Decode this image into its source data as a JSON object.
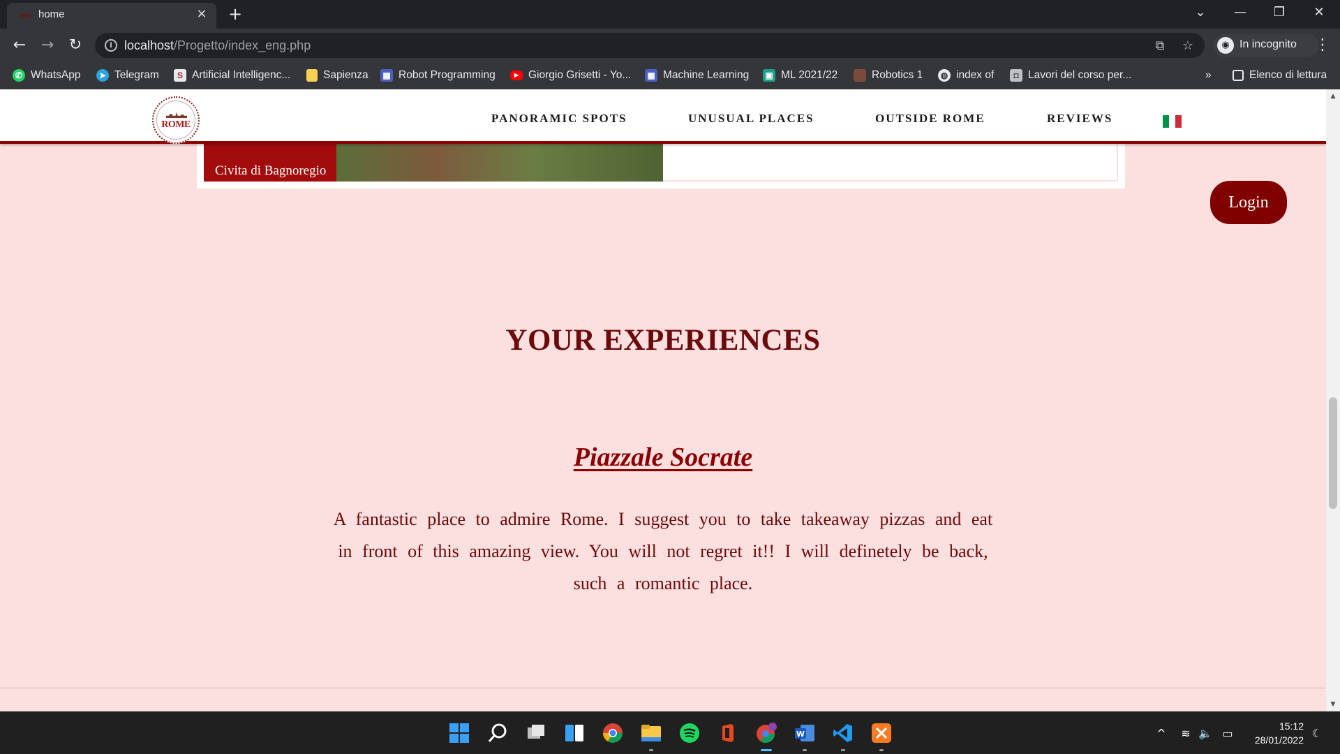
{
  "browser": {
    "tab": {
      "title": "home",
      "close_glyph": "×"
    },
    "new_tab_glyph": "+",
    "window": {
      "tabsearch_glyph": "⌄",
      "minimize_glyph": "—",
      "restore_glyph": "❐",
      "close_glyph": "✕"
    },
    "toolbar": {
      "back_glyph": "←",
      "forward_glyph": "→",
      "reload_glyph": "↻",
      "url_host": "localhost",
      "url_path": "/Progetto/index_eng.php",
      "translate_glyph": "⧉",
      "star_glyph": "☆",
      "incognito_label": "In incognito",
      "menu_glyph": "⋮"
    },
    "bookmarks": [
      {
        "label": "WhatsApp",
        "icon": "whatsapp-icon",
        "color": "#25d366"
      },
      {
        "label": "Telegram",
        "icon": "telegram-icon",
        "color": "#2aa3e0"
      },
      {
        "label": "Artificial Intelligenc...",
        "icon": "s-icon",
        "color": "#e8eaed"
      },
      {
        "label": "Sapienza",
        "icon": "folder-icon",
        "color": "#f7d154"
      },
      {
        "label": "Robot Programming",
        "icon": "classroom-icon",
        "color": "#4a5fc1"
      },
      {
        "label": "Giorgio Grisetti - Yo...",
        "icon": "youtube-icon",
        "color": "#ff0000"
      },
      {
        "label": "Machine Learning",
        "icon": "classroom-icon",
        "color": "#4a5fc1"
      },
      {
        "label": "ML 2021/22",
        "icon": "classroom-icon",
        "color": "#1e9e8a"
      },
      {
        "label": "Robotics 1",
        "icon": "person-icon",
        "color": "#7a4a3a"
      },
      {
        "label": "index of",
        "icon": "globe-icon",
        "color": "#e8eaed"
      },
      {
        "label": "Lavori del corso per...",
        "icon": "person-icon",
        "color": "#bdc1c6"
      }
    ],
    "bookmarks_overflow": "»",
    "reading_list_label": "Elenco di lettura"
  },
  "site": {
    "logo_text": "ROME",
    "nav": [
      "PANORAMIC SPOTS",
      "UNUSUAL PLACES",
      "OUTSIDE ROME",
      "REVIEWS"
    ],
    "flag_colors": [
      "#009246",
      "#ffffff",
      "#ce2b37"
    ],
    "strip_caption": "Civita di Bagnoregio",
    "login_label": "Login",
    "section_title": "YOUR EXPERIENCES",
    "review": {
      "title": "Piazzale Socrate",
      "text": "A fantastic place to admire Rome. I suggest you to take takeaway pizzas and eat in front of this amazing view. You will not regret it!! I will definetely be back, such a romantic place."
    },
    "accent_color": "#8b0000",
    "background_color": "#fcdfdf"
  },
  "taskbar": {
    "apps": [
      "start-icon",
      "search-icon",
      "task-view-icon",
      "widgets-icon",
      "chrome-icon",
      "file-explorer-icon",
      "spotify-icon",
      "office-icon",
      "chrome-incognito-icon",
      "word-icon",
      "vscode-icon",
      "xampp-icon"
    ],
    "tray": {
      "chevron": "^",
      "wifi": "≋",
      "volume": "🔈",
      "battery": "▭"
    },
    "clock": {
      "time": "15:12",
      "date": "28/01/2022"
    }
  }
}
